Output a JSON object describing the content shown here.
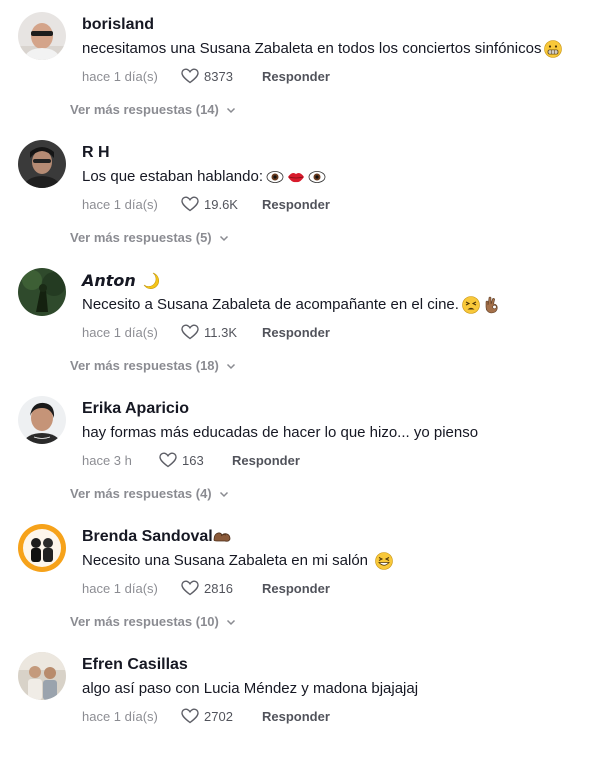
{
  "comments": [
    {
      "username": "borisland",
      "text": "necesitamos una Susana Zabaleta en todos los conciertos sinfónicos",
      "emoji": [
        "grimacing-face-icon"
      ],
      "time": "hace 1 día(s)",
      "likes": "8373",
      "reply_label": "Responder",
      "more_replies": "Ver más respuestas (14)"
    },
    {
      "username": "R H",
      "text": "Los que estaban hablando:",
      "emoji": [
        "eye-icon",
        "lips-icon",
        "eye-icon"
      ],
      "time": "hace 1 día(s)",
      "likes": "19.6K",
      "reply_label": "Responder",
      "more_replies": "Ver más respuestas (5)"
    },
    {
      "username": "𝘼𝙣𝙩𝙤𝙣",
      "username_emoji": [
        "crescent-moon-icon"
      ],
      "text": "Necesito a Susana Zabaleta de acompañante en el cine.",
      "emoji": [
        "tired-face-icon",
        "ok-hand-icon"
      ],
      "time": "hace 1 día(s)",
      "likes": "11.3K",
      "reply_label": "Responder",
      "more_replies": "Ver más respuestas (18)"
    },
    {
      "username": "Erika Aparicio",
      "text": "hay formas más educadas de hacer lo que hizo... yo pienso",
      "emoji": [],
      "time": "hace 3 h",
      "likes": "163",
      "reply_label": "Responder",
      "more_replies": "Ver más respuestas (4)"
    },
    {
      "username": "Brenda Sandoval",
      "username_emoji": [
        "flexed-biceps-icon"
      ],
      "text": "Necesito una Susana Zabaleta en mi salón",
      "emoji": [
        "grinning-squinting-face-icon"
      ],
      "time": "hace 1 día(s)",
      "likes": "2816",
      "reply_label": "Responder",
      "more_replies": "Ver más respuestas (10)"
    },
    {
      "username": "Efren Casillas",
      "text": "algo así paso con Lucia Méndez y madona bjajajaj",
      "emoji": [],
      "time": "hace 1 día(s)",
      "likes": "2702",
      "reply_label": "Responder"
    }
  ],
  "colors": {
    "text_primary": "#161823",
    "text_secondary": "#8a8b91",
    "background": "#ffffff"
  }
}
